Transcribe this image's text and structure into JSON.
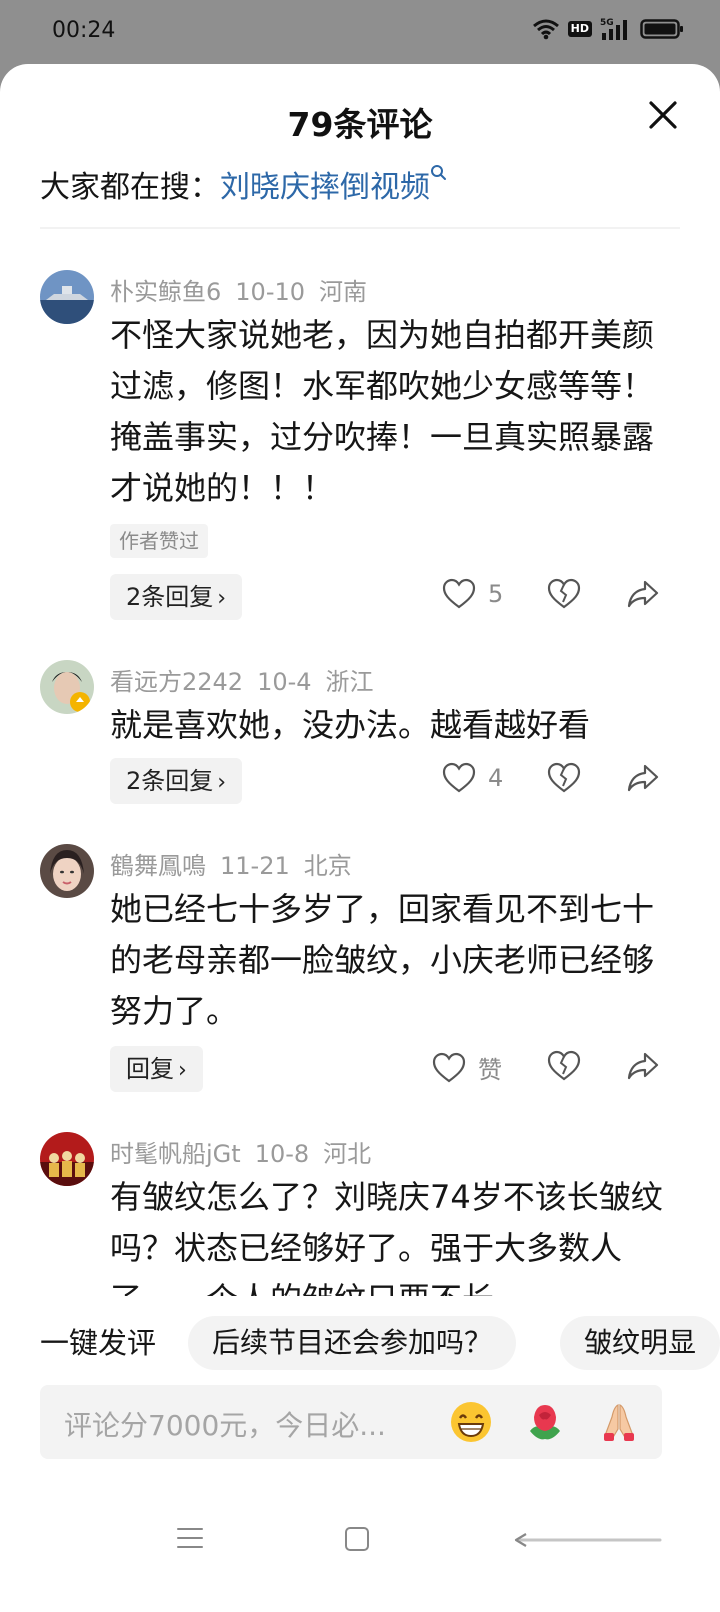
{
  "status_bar": {
    "time": "00:24",
    "icons": [
      "wifi-icon",
      "hd-badge",
      "signal-5g-icon",
      "battery-icon"
    ],
    "hd_label": "HD",
    "network_label": "5G"
  },
  "header": {
    "title": "79条评论",
    "close_icon": "close-icon"
  },
  "search_suggestion": {
    "prefix": "大家都在搜：",
    "query": "刘晓庆摔倒视频",
    "icon": "search-icon"
  },
  "comments": [
    {
      "username": "朴实鲸鱼6",
      "date": "10-10",
      "location": "河南",
      "text": "不怪大家说她老，因为她自拍都开美颜过滤，修图！水军都吹她少女感等等！掩盖事实，过分吹捧！一旦真实照暴露才说她的！！！",
      "badge": "作者赞过",
      "reply_label": "2条回复",
      "likes": "5"
    },
    {
      "username": "看远方2242",
      "date": "10-4",
      "location": "浙江",
      "text": "就是喜欢她，没办法。越看越好看",
      "reply_label": "2条回复",
      "likes": "4"
    },
    {
      "username": "鶴舞鳳鳴",
      "date": "11-21",
      "location": "北京",
      "text": "她已经七十多岁了，回家看见不到七十的老母亲都一脸皱纹，小庆老师已经够努力了。",
      "reply_label": "回复",
      "likes": "赞"
    },
    {
      "username": "时髦帆船jGt",
      "date": "10-8",
      "location": "河北",
      "text": "有皱纹怎么了？刘晓庆74岁不该长皱纹吗？状态已经够好了。强于大多数人了，一个人的皱纹只要不长"
    }
  ],
  "quick_comments": {
    "label": "一键发评",
    "chips": [
      "后续节目还会参加吗？",
      "皱纹明显"
    ]
  },
  "input": {
    "placeholder": "评论分7000元，今日必...",
    "emojis": [
      "grin-emoji-icon",
      "rose-emoji-icon",
      "pray-emoji-icon"
    ]
  },
  "colors": {
    "link": "#2d68a8",
    "sheet_bg": "#ffffff",
    "status_bg": "#8f8f8f",
    "muted": "#9a9a9a"
  }
}
